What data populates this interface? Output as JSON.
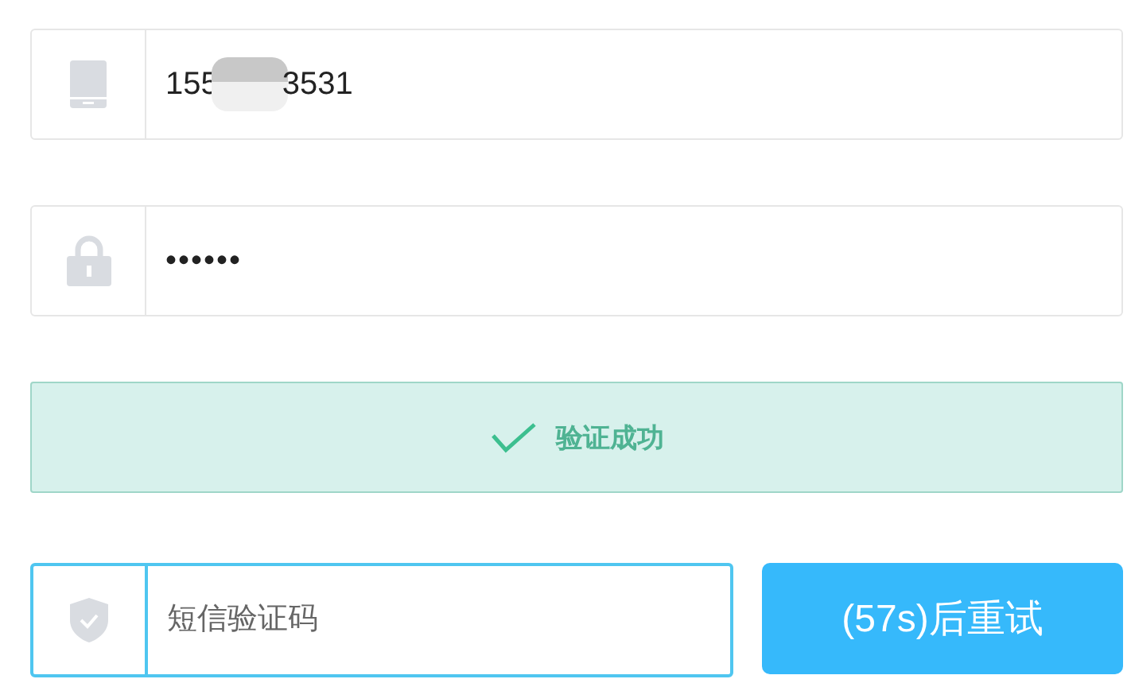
{
  "phone": {
    "value_start": "155",
    "value_end": "3531",
    "redacted": true
  },
  "password": {
    "value": "••••••"
  },
  "verification": {
    "verified": true,
    "text": "验证成功"
  },
  "sms_code": {
    "placeholder": "短信验证码",
    "focused": true
  },
  "resend_button": {
    "label": "(57s)后重试",
    "disabled": false
  }
}
